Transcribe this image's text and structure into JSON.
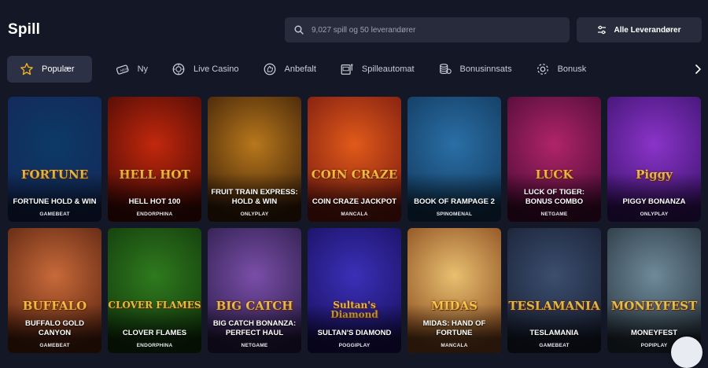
{
  "header": {
    "title": "Spill",
    "search_placeholder": "9,027 spill og 50 leverandører",
    "providers_label": "Alle Leverandører"
  },
  "categories": [
    {
      "label": "Populær",
      "icon": "star-icon",
      "active": true
    },
    {
      "label": "Ny",
      "icon": "new-ticket-icon"
    },
    {
      "label": "Live Casino",
      "icon": "casino-chip-icon"
    },
    {
      "label": "Anbefalt",
      "icon": "thumbs-up-icon"
    },
    {
      "label": "Spilleautomat",
      "icon": "slot-machine-icon"
    },
    {
      "label": "Bonusinnsats",
      "icon": "coin-stack-icon"
    },
    {
      "label": "Bonusk",
      "icon": "gear-icon"
    }
  ],
  "games": [
    {
      "name": "FORTUNE HOLD & WIN",
      "provider": "GAMEBEAT",
      "logo": "FORTUNE",
      "colors": [
        "#0c3a66",
        "#14285a"
      ]
    },
    {
      "name": "HELL HOT 100",
      "provider": "ENDORPHINA",
      "logo": "HELL HOT",
      "colors": [
        "#c2280c",
        "#4a0a06"
      ]
    },
    {
      "name": "FRUIT TRAIN EXPRESS: HOLD & WIN",
      "provider": "ONLYPLAY",
      "logo": "",
      "colors": [
        "#b8781c",
        "#3d2008"
      ]
    },
    {
      "name": "COIN CRAZE JACKPOT",
      "provider": "MANCALA",
      "logo": "COIN CRAZE",
      "colors": [
        "#e15a1a",
        "#7a1a10"
      ]
    },
    {
      "name": "BOOK OF RAMPAGE 2",
      "provider": "SPINOMENAL",
      "logo": "",
      "colors": [
        "#2a6fa6",
        "#123a5e"
      ]
    },
    {
      "name": "LUCK OF TIGER: BONUS COMBO",
      "provider": "NETGAME",
      "logo": "LUCK",
      "colors": [
        "#b0246a",
        "#4c0c36"
      ]
    },
    {
      "name": "PIGGY BONANZA",
      "provider": "ONLYPLAY",
      "logo": "Piggy",
      "colors": [
        "#8a34c8",
        "#3e1470"
      ]
    },
    {
      "name": "BUFFALO GOLD CANYON",
      "provider": "GAMEBEAT",
      "logo": "BUFFALO",
      "colors": [
        "#c86a3a",
        "#5a2410"
      ]
    },
    {
      "name": "CLOVER FLAMES",
      "provider": "ENDORPHINA",
      "logo": "CLOVER FLAMES",
      "colors": [
        "#2f7a1e",
        "#123a0c"
      ]
    },
    {
      "name": "BIG CATCH BONANZA: PERFECT HAUL",
      "provider": "NETGAME",
      "logo": "BIG CATCH",
      "colors": [
        "#7a4ea8",
        "#2c1e4a"
      ]
    },
    {
      "name": "SULTAN'S DIAMOND",
      "provider": "POGGIPLAY",
      "logo": "Sultan's Diamond",
      "colors": [
        "#3a30b8",
        "#1a1060"
      ]
    },
    {
      "name": "MIDAS: HAND OF FORTUNE",
      "provider": "MANCALA",
      "logo": "MIDAS",
      "colors": [
        "#e8c070",
        "#8a4a1e"
      ]
    },
    {
      "name": "TESLAMANIA",
      "provider": "GAMEBEAT",
      "logo": "TESLAMANIA",
      "colors": [
        "#3a4e6e",
        "#1a2034"
      ]
    },
    {
      "name": "MONEYFEST",
      "provider": "POPIPLAY",
      "logo": "MONEYFEST",
      "colors": [
        "#6e8a9a",
        "#2a3640"
      ]
    }
  ]
}
